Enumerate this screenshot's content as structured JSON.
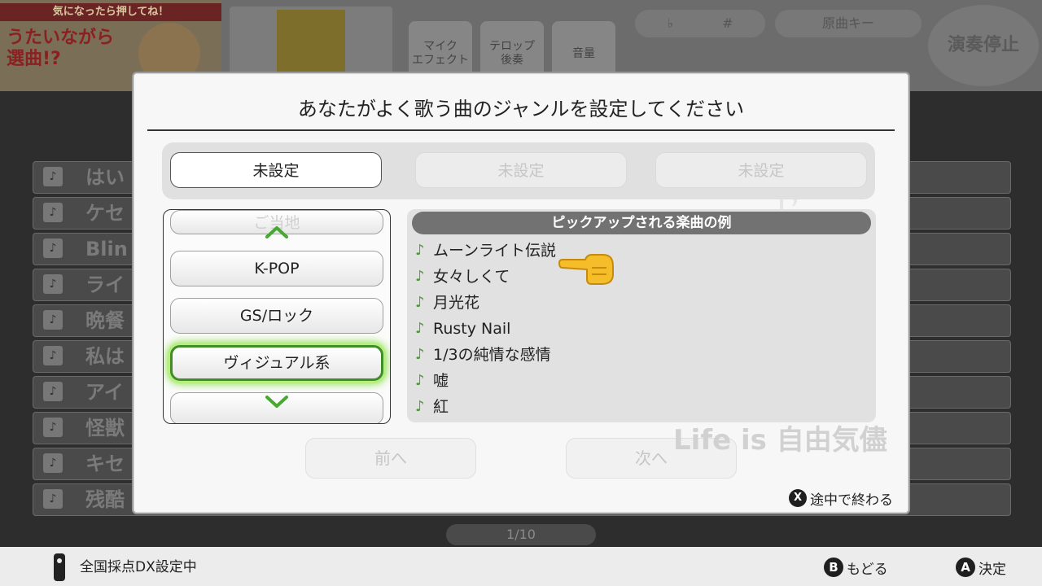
{
  "background": {
    "promo_banner": "気になったら押してね！",
    "promo_text": "うたいながら選曲!?",
    "controls": [
      {
        "label": "マイク\nエフェクト"
      },
      {
        "label": "テロップ\n後奏"
      },
      {
        "label": "音量"
      }
    ],
    "key_flat": "♭",
    "key_sharp": "#",
    "key_original": "原曲キー",
    "stop_label": "演奏停止",
    "rows": [
      "はい",
      "ケセ",
      "Blin",
      "ライ",
      "晩餐",
      "私は",
      "アイ",
      "怪獣",
      "キセ",
      "残酷"
    ],
    "page_indicator": "1/10"
  },
  "dialog": {
    "title": "あなたがよく歌う曲のジャンルを設定してください",
    "slots": [
      {
        "label": "未設定",
        "state": "active"
      },
      {
        "label": "未設定",
        "state": "inactive"
      },
      {
        "label": "未設定",
        "state": "inactive"
      }
    ],
    "genre_list": {
      "partial_top": "ご当地",
      "items": [
        "K-POP",
        "GS/ロック",
        "ヴィジュアル系"
      ],
      "selected": "ヴィジュアル系"
    },
    "pickup": {
      "header": "ピックアップされる楽曲の例",
      "songs": [
        "ムーンライト伝説",
        "女々しくて",
        "月光花",
        "Rusty Nail",
        "1/3の純情な感情",
        "嘘",
        "紅"
      ]
    },
    "prev_label": "前へ",
    "next_label": "次へ",
    "watermark": "Life is 自由気儘",
    "quit_key": "X",
    "quit_label": "途中で終わる"
  },
  "status_bar": {
    "text": "全国採点DX設定中",
    "back_key": "B",
    "back_label": "もどる",
    "ok_key": "A",
    "ok_label": "決定"
  },
  "colors": {
    "accent_green": "#3f8e27",
    "glow_green": "#8de04e",
    "header_gray": "#727272",
    "note_green": "#4e9a37"
  }
}
